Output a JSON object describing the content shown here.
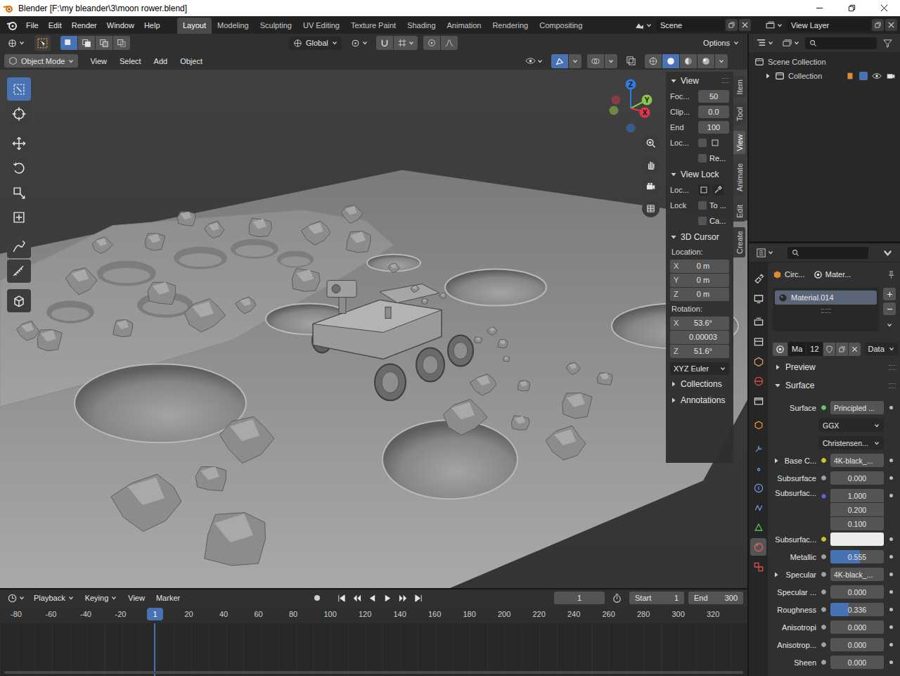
{
  "window": {
    "title": "Blender [F:\\my bleander\\3\\moon rower.blend]"
  },
  "menus": [
    "File",
    "Edit",
    "Render",
    "Window",
    "Help"
  ],
  "workspaces": [
    {
      "label": "Layout",
      "selected": true
    },
    {
      "label": "Modeling",
      "selected": false
    },
    {
      "label": "Sculpting",
      "selected": false
    },
    {
      "label": "UV Editing",
      "selected": false
    },
    {
      "label": "Texture Paint",
      "selected": false
    },
    {
      "label": "Shading",
      "selected": false
    },
    {
      "label": "Animation",
      "selected": false
    },
    {
      "label": "Rendering",
      "selected": false
    },
    {
      "label": "Compositing",
      "selected": false
    }
  ],
  "scene": "Scene",
  "view_layer": "View Layer",
  "tool_header": {
    "orientation": "Global",
    "options": "Options",
    "select_modes": [
      {
        "selected": true
      },
      {
        "selected": false
      },
      {
        "selected": false
      },
      {
        "selected": false
      }
    ]
  },
  "viewport_header": {
    "mode": "Object Mode",
    "menus": [
      "View",
      "Select",
      "Add",
      "Object"
    ],
    "shading": [
      {
        "selected": false
      },
      {
        "selected": true
      },
      {
        "selected": false
      },
      {
        "selected": false
      }
    ]
  },
  "toolbar": [
    {
      "selected": true
    },
    {
      "selected": false
    },
    {
      "selected": false
    },
    {
      "selected": false
    },
    {
      "selected": false
    },
    {
      "selected": false
    },
    {
      "selected": false
    },
    {
      "selected": false
    },
    {
      "selected": false
    }
  ],
  "gizmo": {
    "axes": [
      {
        "label": "Z",
        "color": "#2f7be0"
      },
      {
        "label": "Y",
        "color": "#8cc34a"
      },
      {
        "label": "X",
        "color": "#e0364a"
      }
    ]
  },
  "npanel": {
    "tabs": [
      {
        "label": "Item",
        "selected": false
      },
      {
        "label": "Tool",
        "selected": false
      },
      {
        "label": "View",
        "selected": true
      },
      {
        "label": "Animate",
        "selected": false
      },
      {
        "label": "Edit",
        "selected": false
      },
      {
        "label": "Create",
        "selected": false
      }
    ],
    "view": {
      "title": "View",
      "expanded": true,
      "fields": [
        {
          "label": "Foc...",
          "value": "50"
        },
        {
          "label": "Clip...",
          "value": "0.0"
        },
        {
          "label": "End",
          "value": "100"
        }
      ],
      "local": {
        "label": "Loc...",
        "checked": false
      },
      "render": {
        "label": "Re...",
        "checked": false
      }
    },
    "view_lock": {
      "title": "View Lock",
      "expanded": true,
      "object_label": "Loc...",
      "lock_label": "Lock",
      "checks": [
        {
          "label": "To ...",
          "checked": false
        },
        {
          "label": "Ca...",
          "checked": false
        }
      ]
    },
    "cursor": {
      "title": "3D Cursor",
      "expanded": true,
      "location_label": "Location:",
      "location": [
        {
          "axis": "X",
          "value": "0 m"
        },
        {
          "axis": "Y",
          "value": "0 m"
        },
        {
          "axis": "Z",
          "value": "0 m"
        }
      ],
      "rotation_label": "Rotation:",
      "rotation": [
        {
          "axis": "X",
          "value": "53.6°"
        },
        {
          "axis": "",
          "value": "0.00003"
        },
        {
          "axis": "Z",
          "value": "51.6°"
        }
      ],
      "mode": "XYZ Euler"
    },
    "collapsed": [
      {
        "title": "Collections",
        "expanded": false
      },
      {
        "title": "Annotations",
        "expanded": false
      }
    ]
  },
  "timeline": {
    "menus": [
      "Playback",
      "Keying",
      "View",
      "Marker"
    ],
    "frame": "1",
    "start_label": "Start",
    "start": "1",
    "end_label": "End",
    "end": "300",
    "ruler": [
      "-80",
      "-60",
      "-40",
      "-20",
      "20",
      "40",
      "60",
      "80",
      "100",
      "120",
      "140",
      "160",
      "180",
      "200",
      "220",
      "240",
      "260",
      "280",
      "300",
      "320"
    ],
    "current": "1"
  },
  "outliner": {
    "items": [
      {
        "label": "Scene Collection",
        "depth": 0,
        "expanded": true
      },
      {
        "label": "Collection",
        "depth": 1,
        "expanded": false,
        "checked": true,
        "visible": true,
        "renderable": true
      }
    ]
  },
  "properties": {
    "tabs": [
      {
        "selected": false
      },
      {
        "selected": false
      },
      {
        "selected": false
      },
      {
        "selected": false
      },
      {
        "selected": false
      },
      {
        "selected": false
      },
      {
        "selected": false
      },
      {
        "selected": false
      },
      {
        "selected": false
      },
      {
        "selected": false
      },
      {
        "selected": false
      },
      {
        "selected": false
      },
      {
        "selected": false
      },
      {
        "selected": true
      },
      {
        "selected": false
      }
    ],
    "breadcrumb": [
      "Circ...",
      "Mater..."
    ],
    "slots": [
      {
        "name": "Material.014",
        "selected": true
      }
    ],
    "material": {
      "name": "Ma",
      "users": "12",
      "link": "Data"
    },
    "sections": [
      {
        "title": "Preview",
        "expanded": false
      },
      {
        "title": "Surface",
        "expanded": true
      }
    ],
    "rows": [
      {
        "label": "Surface",
        "kind": "link",
        "socket": "#63c763",
        "value": "Principled ...",
        "expandable": false
      },
      {
        "label": "",
        "kind": "dropdown",
        "value": "GGX",
        "expandable": false
      },
      {
        "label": "",
        "kind": "dropdown",
        "value": "Christensen...",
        "expandable": false
      },
      {
        "label": "Base C...",
        "kind": "link",
        "socket": "#c7c729",
        "value": "4K-black_...",
        "expandable": true
      },
      {
        "label": "Subsurface",
        "kind": "number",
        "socket": "#a1a1a1",
        "value": "0.000",
        "level": 0,
        "expandable": false
      },
      {
        "label": "Subsurfac...",
        "kind": "vector",
        "socket": "#6363c7",
        "values": [
          "1.000",
          "0.200",
          "0.100"
        ],
        "expandable": false
      },
      {
        "label": "Subsurfac...",
        "kind": "color",
        "socket": "#c7c729",
        "swatch": "#ececec",
        "expandable": false
      },
      {
        "label": "Metallic",
        "kind": "number",
        "socket": "#a1a1a1",
        "value": "0.555",
        "level": 0.555,
        "expandable": false
      },
      {
        "label": "Specular",
        "kind": "link",
        "socket": "#a1a1a1",
        "value": "4K-black_...",
        "expandable": true
      },
      {
        "label": "Specular ...",
        "kind": "number",
        "socket": "#a1a1a1",
        "value": "0.000",
        "level": 0,
        "expandable": false
      },
      {
        "label": "Roughness",
        "kind": "number",
        "socket": "#a1a1a1",
        "value": "0.336",
        "level": 0.336,
        "expandable": false
      },
      {
        "label": "Anisotropi",
        "kind": "number",
        "socket": "#a1a1a1",
        "value": "0.000",
        "level": 0,
        "expandable": false
      },
      {
        "label": "Anisotrop...",
        "kind": "number",
        "socket": "#a1a1a1",
        "value": "0.000",
        "level": 0,
        "expandable": false
      },
      {
        "label": "Sheen",
        "kind": "number",
        "socket": "#a1a1a1",
        "value": "0.000",
        "level": 0,
        "expandable": false
      }
    ]
  }
}
